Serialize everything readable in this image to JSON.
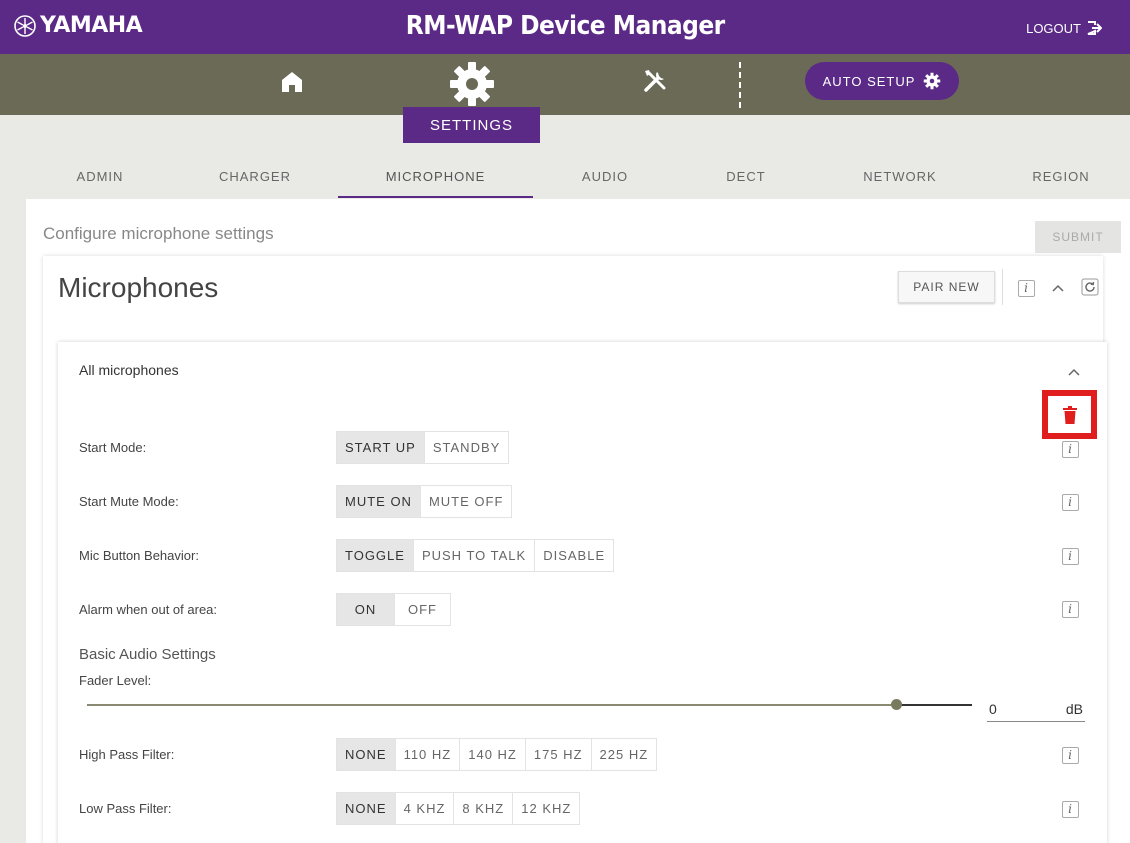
{
  "header": {
    "brand": "YAMAHA",
    "title": "RM-WAP Device Manager",
    "logout_label": "LOGOUT"
  },
  "nav": {
    "auto_setup_label": "AUTO SETUP",
    "active_label": "SETTINGS"
  },
  "subtabs": [
    "ADMIN",
    "CHARGER",
    "MICROPHONE",
    "AUDIO",
    "DECT",
    "NETWORK",
    "REGION"
  ],
  "page": {
    "description": "Configure microphone settings",
    "submit_label": "SUBMIT"
  },
  "microphones": {
    "title": "Microphones",
    "pair_new_label": "PAIR NEW",
    "group_title": "All microphones",
    "rows": {
      "start_mode": {
        "label": "Start Mode:",
        "options": [
          "START UP",
          "STANDBY"
        ],
        "selected": "START UP"
      },
      "start_mute_mode": {
        "label": "Start Mute Mode:",
        "options": [
          "MUTE ON",
          "MUTE OFF"
        ],
        "selected": "MUTE ON"
      },
      "mic_button": {
        "label": "Mic Button Behavior:",
        "options": [
          "TOGGLE",
          "PUSH TO TALK",
          "DISABLE"
        ],
        "selected": "TOGGLE"
      },
      "alarm": {
        "label": "Alarm when out of area:",
        "options": [
          "ON",
          "OFF"
        ],
        "selected": "ON"
      },
      "high_pass": {
        "label": "High Pass Filter:",
        "options": [
          "NONE",
          "110 HZ",
          "140 HZ",
          "175 HZ",
          "225 HZ"
        ],
        "selected": "NONE"
      },
      "low_pass": {
        "label": "Low Pass Filter:",
        "options": [
          "NONE",
          "4 KHZ",
          "8 KHZ",
          "12 KHZ"
        ],
        "selected": "NONE"
      }
    },
    "basic_audio": {
      "title": "Basic Audio Settings",
      "fader_label": "Fader Level:",
      "fader_value": "0",
      "fader_unit": "dB"
    }
  },
  "colors": {
    "brand_purple": "#5b2a86",
    "nav_olive": "#6a6a56",
    "delete_highlight": "#e01e1e"
  }
}
